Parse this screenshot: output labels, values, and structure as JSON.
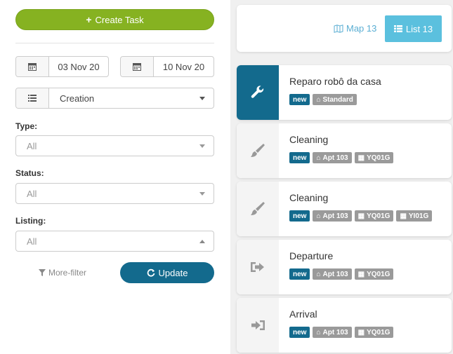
{
  "filters": {
    "create_label": "Create Task",
    "date_from": "03 Nov 20",
    "date_to": "10 Nov 20",
    "sort_value": "Creation",
    "type_label": "Type:",
    "type_value": "All",
    "status_label": "Status:",
    "status_value": "All",
    "listing_label": "Listing:",
    "listing_value": "All",
    "more_filter_label": "More-filter",
    "update_label": "Update"
  },
  "view": {
    "map_label": "Map 13",
    "list_label": "List 13"
  },
  "colors": {
    "create": "#86b221",
    "primary": "#136a8d",
    "list_active": "#5bc0de",
    "tag_gray": "#9a9a9a"
  },
  "tasks": [
    {
      "title": "Reparo robô da casa",
      "icon": "wrench-icon",
      "tags": [
        "new",
        "Standard"
      ]
    },
    {
      "title": "Cleaning",
      "icon": "brush-icon",
      "tags": [
        "new",
        "Apt 103",
        "YQ01G"
      ]
    },
    {
      "title": "Cleaning",
      "icon": "brush-icon",
      "tags": [
        "new",
        "Apt 103",
        "YQ01G",
        "YI01G"
      ]
    },
    {
      "title": "Departure",
      "icon": "sign-out-icon",
      "tags": [
        "new",
        "Apt 103",
        "YQ01G"
      ]
    },
    {
      "title": "Arrival",
      "icon": "sign-in-icon",
      "tags": [
        "new",
        "Apt 103",
        "YQ01G"
      ]
    }
  ]
}
